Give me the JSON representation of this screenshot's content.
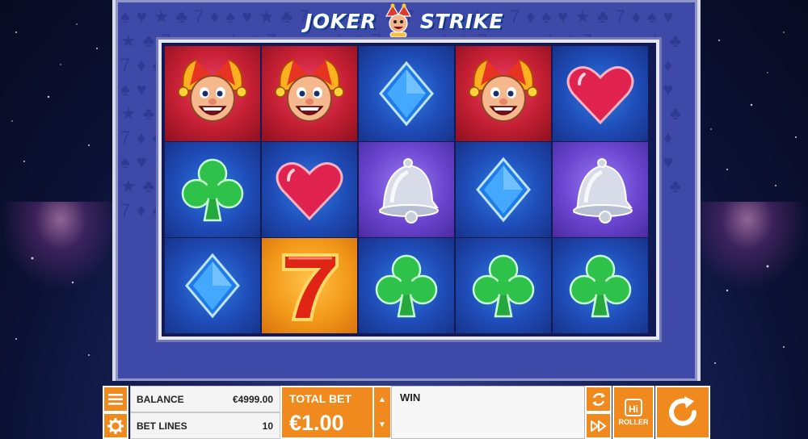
{
  "game": {
    "title_left": "JOKER",
    "title_right": "STRIKE"
  },
  "reels": [
    [
      "joker",
      "joker",
      "diamond",
      "joker",
      "heart"
    ],
    [
      "club",
      "heart",
      "bell",
      "diamond",
      "bell"
    ],
    [
      "diamond",
      "seven",
      "club",
      "club",
      "club"
    ]
  ],
  "hud": {
    "menu_icon": "hamburger-menu-icon",
    "settings_icon": "gear-icon",
    "balance_label": "BALANCE",
    "balance_value": "€4999.00",
    "bet_lines_label": "BET LINES",
    "bet_lines_value": "10",
    "total_bet_label": "TOTAL BET",
    "total_bet_value": "€1.00",
    "bet_up_icon": "triangle-up-icon",
    "bet_down_icon": "triangle-down-icon",
    "win_label": "WIN",
    "win_value": "",
    "autoplay_icon": "loop-arrows-icon",
    "fast_forward_icon": "fast-forward-icon",
    "hiroller_badge": "Hi",
    "hiroller_label": "ROLLER",
    "spin_icon": "circular-arrow-spin-icon"
  },
  "colors": {
    "hud_orange": "#f08a1f",
    "frame_blue": "#3f4aa8"
  }
}
